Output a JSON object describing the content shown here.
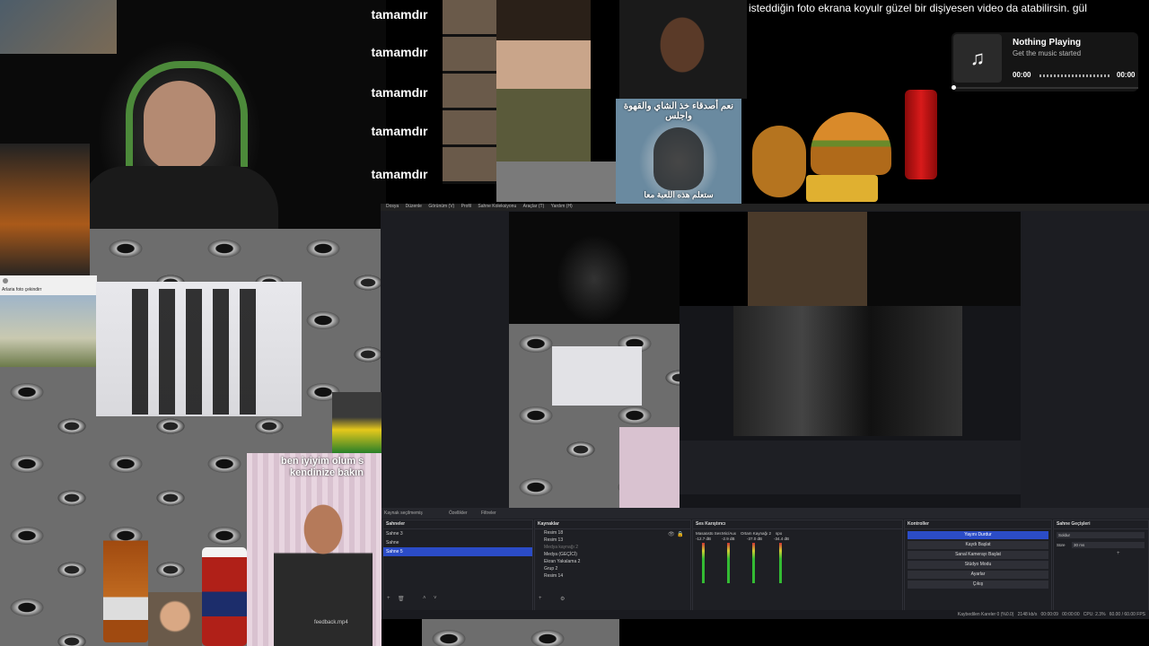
{
  "marquee": "isteddiğin foto ekrana koyulr güzel bir dişiyesen video da atabilirsin. gül",
  "tamamdir": [
    "tamamdır",
    "tamamdır",
    "tamamdır",
    "tamamdır",
    "tamamdır"
  ],
  "arabic_text": "نعم أصدقاء خذ الشاي والقهوة واجلس",
  "arabic_bottom": "ستعلم هذه اللعبة معا",
  "fb_post": "Arlaria foto çekindirr",
  "meme_caption_1": "ben iyiyim olum s",
  "meme_caption_2": "kendinize bakın",
  "video_label": "feedback.mp4",
  "music": {
    "title": "Nothing Playing",
    "subtitle": "Get the music started",
    "time_start": "00:00",
    "time_end": "00:00",
    "progress": 0
  },
  "obs": {
    "menu": [
      "Dosya",
      "Düzenle",
      "Görünüm (V)",
      "Profil",
      "Sahne Koleksiyonu",
      "Araçlar (T)",
      "Yardım (H)"
    ],
    "context": {
      "no_source": "Kaynak seçilmemiş",
      "filters": "Filtreler",
      "props": "Özellikler"
    },
    "scenes": {
      "title": "Sahneler",
      "items": [
        "Sahne 3",
        "Sahne",
        "Sahne 5"
      ],
      "selected": 2
    },
    "sources": {
      "title": "Kaynaklar",
      "items": [
        "Resim 18",
        "Resim 13",
        "Medya kaynağı 2",
        "Medya (GEÇİCİ)",
        "Ekran Yakalama 2",
        "Grup 2",
        "Resim 14"
      ]
    },
    "mixer": {
      "title": "Ses Karıştırıcı",
      "channels": [
        {
          "name": "Masaüstü Ses",
          "db": "-12.7 dB"
        },
        {
          "name": "Mic/Aux",
          "db": "-2.9 dB"
        },
        {
          "name": "Ortam Kaynağı 2",
          "db": "-37.0 dB"
        },
        {
          "name": "spo",
          "db": "-34.4 dB"
        }
      ]
    },
    "controls": {
      "title": "Kontroller",
      "buttons": [
        "Yayını Durdur",
        "Kaydı Başlat",
        "Sanal Kamerayı Başlat",
        "Stüdyo Modu",
        "Ayarlar",
        "Çıkış"
      ]
    },
    "transitions": {
      "title": "Sahne Geçişleri",
      "type": "Soldur",
      "duration_label": "Süre",
      "duration": "30 ms"
    },
    "status": {
      "dropped": "Kaybedilen Kareler 0 (%0.0)",
      "bitrate": "2148 kb/s",
      "live": "00:00:09",
      "rec": "00:00:00",
      "cpu": "CPU: 2.3%",
      "fps": "60.00 / 60.00 FPS"
    }
  }
}
